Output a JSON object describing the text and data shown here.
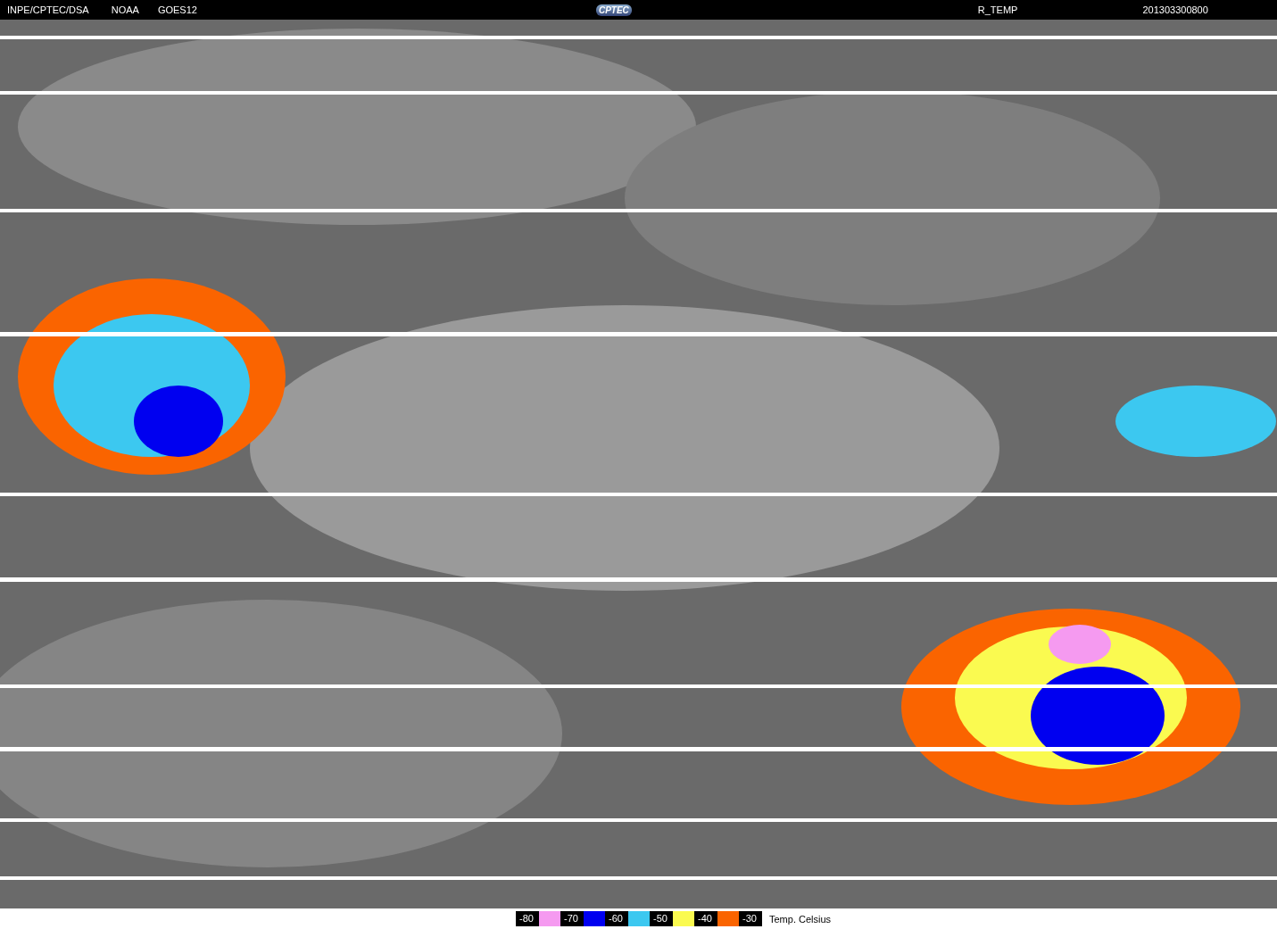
{
  "header": {
    "source": "INPE/CPTEC/DSA",
    "agency": "NOAA",
    "satellite": "GOES12",
    "logo": "CPTEC",
    "product": "R_TEMP",
    "timestamp": "201303300800"
  },
  "legend": {
    "items": [
      {
        "label": "-80",
        "color": "#f59af0"
      },
      {
        "label": "-70",
        "color": "#0000f0"
      },
      {
        "label": "-60",
        "color": "#3cc8f0"
      },
      {
        "label": "-50",
        "color": "#fafa50"
      },
      {
        "label": "-40",
        "color": "#fa6400"
      },
      {
        "label": "-30"
      }
    ],
    "unit": "Temp. Celsius"
  }
}
